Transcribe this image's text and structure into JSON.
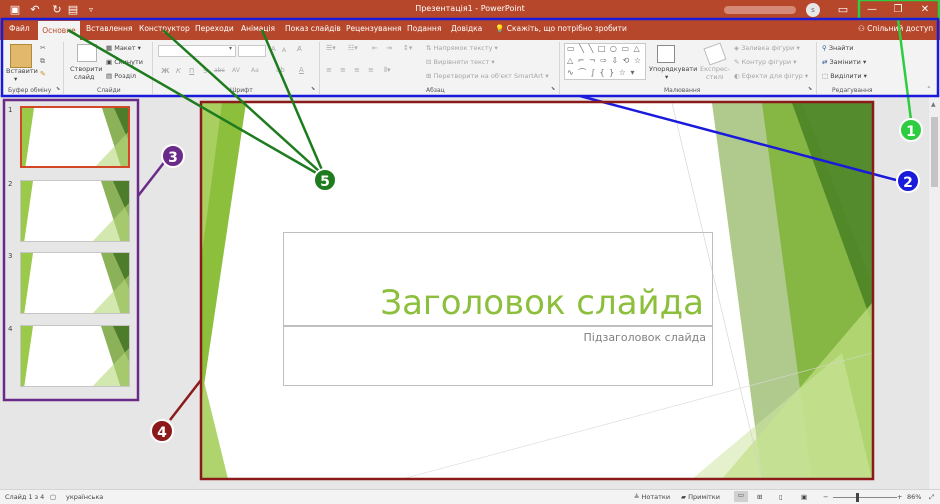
{
  "window": {
    "title": "Презентація1  -  PowerPoint",
    "avatar_letter": "s",
    "qat_icons": [
      "save-icon",
      "undo-icon",
      "redo-icon",
      "start-presentation-icon",
      "customize-qat-icon"
    ],
    "controls": {
      "minimize": "—",
      "restore": "❐",
      "close": "✕"
    }
  },
  "tabs": [
    "Файл",
    "Основне",
    "Вставлення",
    "Конструктор",
    "Переходи",
    "Анімація",
    "Показ слайдів",
    "Рецензування",
    "Подання",
    "Довідка"
  ],
  "active_tab": "Основне",
  "tell_me": "Скажіть, що потрібно зробити",
  "share": "Спільний доступ",
  "ribbon": {
    "clipboard": {
      "paste": "Вставити",
      "label": "Буфер обміну"
    },
    "slides": {
      "new_slide_1": "Створити",
      "new_slide_2": "слайд",
      "layout": "Макет",
      "reset": "Скинути",
      "section": "Розділ",
      "label": "Слайди"
    },
    "font": {
      "label": "Шрифт",
      "bold": "Ж",
      "italic": "К",
      "underline": "П",
      "strike": "S",
      "shadow": "abc",
      "spacing": "AV",
      "case": "Aa",
      "grow": "A",
      "shrink": "A",
      "color": "A"
    },
    "paragraph": {
      "direction": "Напрямок тексту",
      "align": "Вирівняти текст",
      "smartart": "Перетворити на об'єкт SmartArt",
      "label": "Абзац"
    },
    "drawing": {
      "arrange": "Упорядкувати",
      "quick_styles_1": "Експрес-",
      "quick_styles_2": "стилі",
      "fill": "Заливка фігури",
      "outline": "Контур фігури",
      "effects": "Ефекти для фігур",
      "label": "Малювання"
    },
    "editing": {
      "find": "Знайти",
      "replace": "Замінити",
      "select": "Виділити",
      "label": "Редагування"
    }
  },
  "thumbnails": [
    "1",
    "2",
    "3",
    "4"
  ],
  "slide": {
    "title": "Заголовок слайда",
    "subtitle": "Підзаголовок слайда"
  },
  "status": {
    "slide_info": "Слайд 1 з 4",
    "language": "українська",
    "notes": "Нотатки",
    "comments": "Примітки",
    "zoom": "86%",
    "minus": "−",
    "plus": "+"
  },
  "annotations": [
    "1",
    "2",
    "3",
    "4",
    "5"
  ],
  "colors": {
    "brand": "#b7472a",
    "accent_green": "#8cbf3c",
    "ann1": "#2ecc40",
    "ann2": "#1a1adb",
    "ann3": "#6a2a8a",
    "ann4": "#8b1a1a",
    "ann5": "#1e7b1e"
  }
}
